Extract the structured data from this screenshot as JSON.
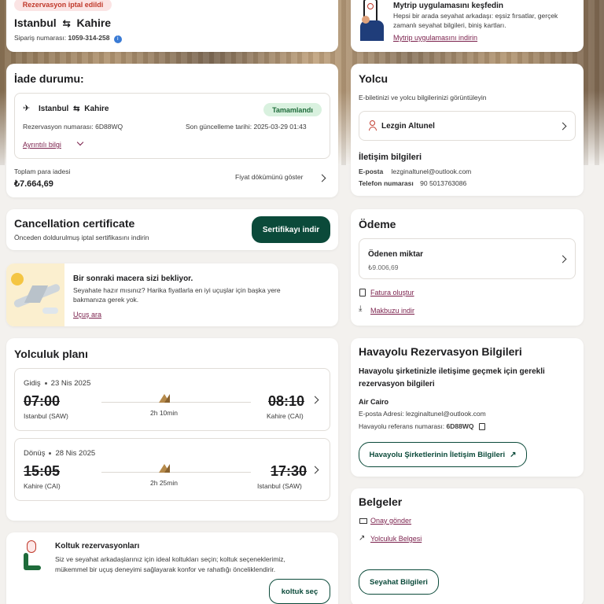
{
  "booking": {
    "status_badge": "Rezervasyon iptal edildi",
    "from": "Istanbul",
    "to": "Kahire",
    "order_label": "Sipariş numarası:",
    "order_number": "1059-314-258"
  },
  "app_promo": {
    "title": "Mytrip uygulamasını keşfedin",
    "text_line1": "Hepsi bir arada seyahat arkadaşı: eşsiz fırsatlar, gerçek",
    "text_line2": "zamanlı seyahat bilgileri, biniş kartları.",
    "link": "Mytrip uygulamasını indirin"
  },
  "refund": {
    "title": "İade durumu:",
    "route_from": "Istanbul",
    "route_to": "Kahire",
    "status": "Tamamlandı",
    "reservation_label": "Rezervasyon numarası: 6D88WQ",
    "updated_label": "Son güncelleme tarihi: 2025-03-29 01:43",
    "details_link": "Ayrıntılı bilgi",
    "total_label": "Toplam para iadesi",
    "total_value": "₺7.664,69",
    "breakdown_link": "Fiyat dökümünü göster"
  },
  "certificate": {
    "title": "Cancellation certificate",
    "subtitle": "Önceden doldurulmuş iptal sertifikasını indirin",
    "button": "Sertifikayı indir"
  },
  "adventure": {
    "title": "Bir sonraki macera sizi bekliyor.",
    "text_line1": "Seyahate hazır mısınız? Harika fiyatlarla en iyi uçuşlar için başka yere",
    "text_line2": "bakmanıza gerek yok.",
    "link": "Uçuş ara"
  },
  "itinerary": {
    "title": "Yolculuk planı",
    "legs": [
      {
        "label": "Gidiş",
        "date": "23 Nis 2025",
        "dep_time": "07:00",
        "dep_place": "Istanbul (SAW)",
        "duration": "2h 10min",
        "arr_time": "08:10",
        "arr_place": "Kahire (CAI)"
      },
      {
        "label": "Dönüş",
        "date": "28 Nis 2025",
        "dep_time": "15:05",
        "dep_place": "Kahire (CAI)",
        "duration": "2h 25min",
        "arr_time": "17:30",
        "arr_place": "Istanbul (SAW)"
      }
    ]
  },
  "seats": {
    "title": "Koltuk rezervasyonları",
    "text_line1": "Siz ve seyahat arkadaşlarınız için ideal koltukları seçin; koltuk seçeneklerimiz,",
    "text_line2": "mükemmel bir uçuş deneyimi sağlayarak konfor ve rahatlığı önceliklendirir.",
    "button": "koltuk seç"
  },
  "passenger": {
    "title": "Yolcu",
    "subtitle": "E-biletinizi ve yolcu bilgilerinizi görüntüleyin",
    "name": "Lezgin Altunel",
    "contact_title": "İletişim bilgileri",
    "email_label": "E-posta",
    "email_value": "lezginaltunel@outlook.com",
    "phone_label": "Telefon numarası",
    "phone_value": "90 5013763086"
  },
  "payment": {
    "title": "Ödeme",
    "paid_label": "Ödenen miktar",
    "paid_value": "₺9.006,69",
    "invoice_link": "Fatura oluştur",
    "receipt_link": "Makbuzu indir"
  },
  "airline": {
    "title": "Havayolu Rezervasyon Bilgileri",
    "subtitle_line1": "Havayolu şirketinizle iletişime geçmek için gerekli",
    "subtitle_line2": "rezervasyon bilgileri",
    "carrier": "Air Cairo",
    "email_line": "E-posta Adresi: lezginaltunel@outlook.com",
    "ref_label": "Havayolu referans numarası:",
    "ref_value": "6D88WQ",
    "button": "Havayolu Şirketlerinin İletişim Bilgileri"
  },
  "documents": {
    "title": "Belgeler",
    "confirm_link": "Onay gönder",
    "travel_doc_link": "Yolculuk Belgesi",
    "button": "Seyahat Bilgileri"
  },
  "colors": {
    "brand_dark": "#0b4a3a",
    "link": "#7a1f4b",
    "cancel_red": "#c0392b",
    "complete_green": "#1e6b3a"
  }
}
